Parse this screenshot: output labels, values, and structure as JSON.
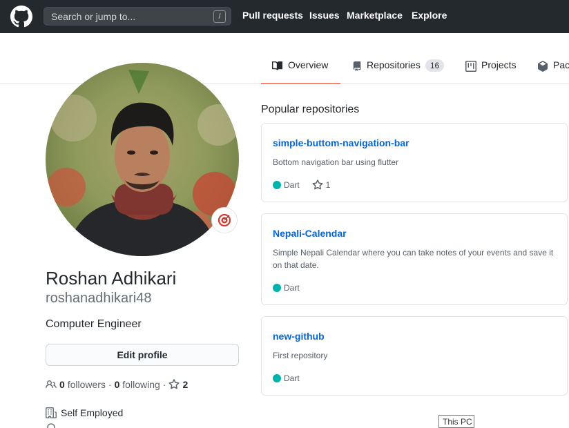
{
  "header": {
    "search_placeholder": "Search or jump to...",
    "search_shortcut": "/",
    "nav": [
      "Pull requests",
      "Issues",
      "Marketplace",
      "Explore"
    ]
  },
  "tabs": {
    "overview": "Overview",
    "repositories": "Repositories",
    "repositories_count": "16",
    "projects": "Projects",
    "packages": "Pac"
  },
  "profile": {
    "full_name": "Roshan Adhikari",
    "username": "roshanadhikari48",
    "bio": "Computer Engineer",
    "edit_button": "Edit profile",
    "followers_count": "0",
    "followers_label": "followers",
    "following_count": "0",
    "following_label": "following",
    "stars_count": "2",
    "company": "Self Employed"
  },
  "popular": {
    "title": "Popular repositories",
    "repos": [
      {
        "name": "simple-buttom-navigation-bar",
        "description": "Bottom navigation bar using flutter",
        "language": "Dart",
        "stars": "1"
      },
      {
        "name": "Nepali-Calendar",
        "description": "Simple Nepali Calendar where you can take notes of your events and save it on that date.",
        "language": "Dart"
      },
      {
        "name": "new-github",
        "description": "First repository",
        "language": "Dart"
      }
    ]
  },
  "tooltip": {
    "text": "This PC"
  },
  "colors": {
    "header_bg": "#24292e",
    "accent_tab": "#f9826c",
    "link": "#0366d6",
    "dart": "#00b4ab"
  }
}
